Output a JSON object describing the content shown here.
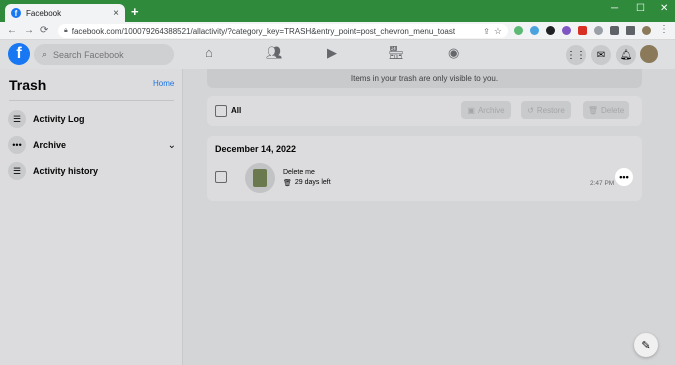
{
  "browser": {
    "tab_title": "Facebook",
    "tab_close": "×",
    "new_tab": "+",
    "url": "facebook.com/100079264388521/allactivity/?category_key=TRASH&entry_point=post_chevron_menu_toast",
    "window_controls": [
      "─",
      "☐",
      "✕"
    ]
  },
  "facebook": {
    "logo": "f",
    "search_placeholder": "Search Facebook",
    "nav_icons": [
      "home-icon",
      "friends-icon",
      "watch-icon",
      "marketplace-icon",
      "groups-icon"
    ],
    "right_icons": [
      "menu-grid-icon",
      "messenger-icon",
      "notifications-icon"
    ]
  },
  "sidebar": {
    "title": "Trash",
    "home_link": "Home",
    "items": [
      {
        "label": "Activity Log",
        "icon": "list-icon"
      },
      {
        "label": "Archive",
        "icon": "more-icon"
      },
      {
        "label": "Activity history",
        "icon": "list-icon"
      }
    ]
  },
  "main": {
    "banner": "Items in your trash are only visible to you.",
    "select_all_label": "All",
    "actions": [
      "Archive",
      "Restore",
      "Delete"
    ],
    "date_header": "December 14, 2022",
    "item": {
      "title": "Delete me",
      "days_left": "29 days left",
      "time": "2:47 PM"
    }
  },
  "colors": {
    "facebook_blue": "#1877f2",
    "browser_frame": "#2f8a3c",
    "link": "#1b74e4"
  }
}
